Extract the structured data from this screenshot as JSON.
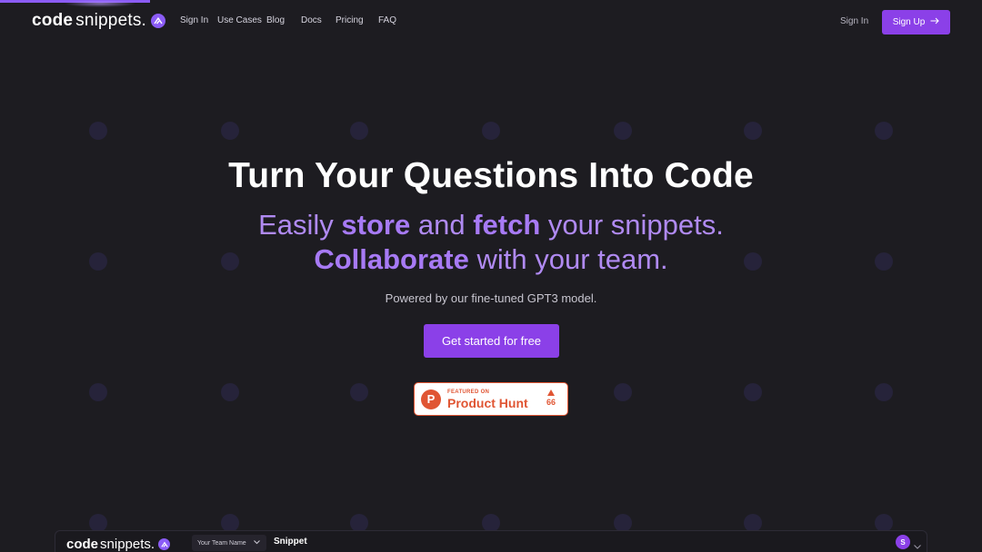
{
  "nav": {
    "logo_code": "code",
    "logo_snippets": "snippets.",
    "links": [
      "Sign In",
      "Use Cases",
      "Blog",
      "Docs",
      "Pricing",
      "FAQ"
    ],
    "signin_right": "Sign In",
    "signup": "Sign Up"
  },
  "hero": {
    "title": "Turn Your Questions Into Code",
    "sub1_a": "Easily ",
    "sub1_b": "store",
    "sub1_c": " and ",
    "sub1_d": "fetch",
    "sub1_e": " your snippets.",
    "sub2_a": "Collaborate",
    "sub2_b": " with your team.",
    "powered": "Powered by our fine-tuned GPT3 model.",
    "cta": "Get started for free"
  },
  "product_hunt": {
    "featured": "FEATURED ON",
    "name": "Product Hunt",
    "letter": "P",
    "votes": "66"
  },
  "app_preview": {
    "logo_code": "code",
    "logo_snippets": "snippets.",
    "team_select": "Your Team Name",
    "title": "Snippet",
    "avatar_letter": "S"
  },
  "colors": {
    "accent": "#8b40e8",
    "background": "#1d1c21",
    "product_hunt": "#e05533"
  }
}
